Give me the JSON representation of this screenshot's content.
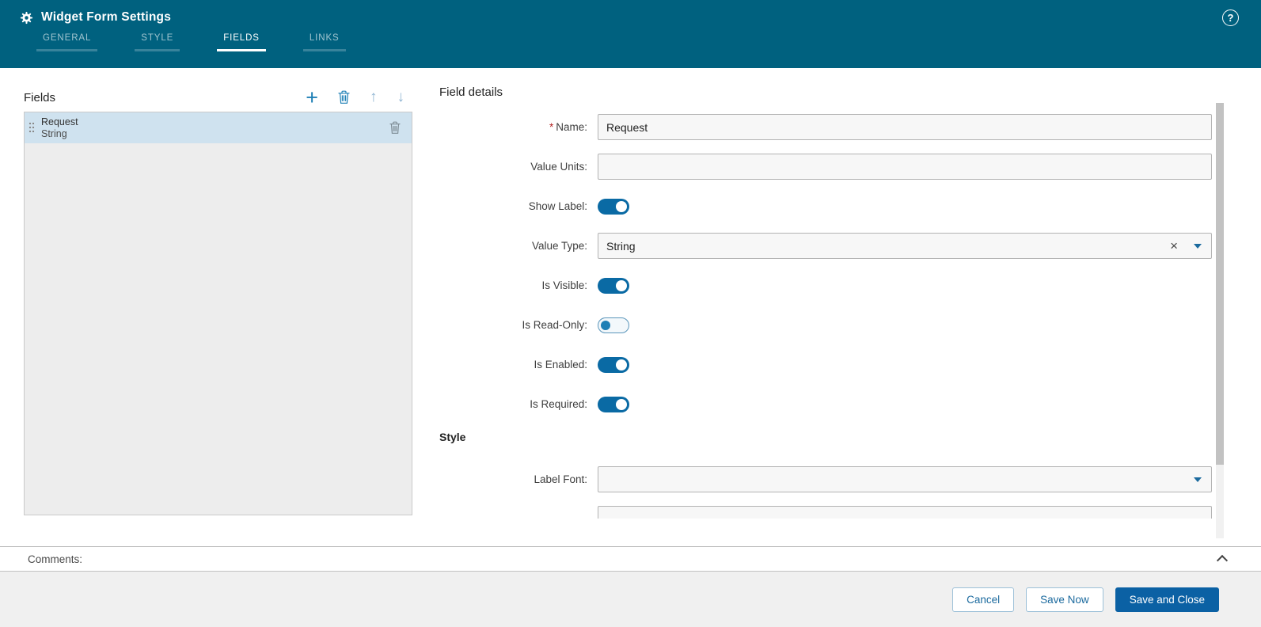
{
  "header": {
    "title": "Widget Form Settings",
    "help_label": "?",
    "tabs": [
      {
        "label": "GENERAL"
      },
      {
        "label": "STYLE"
      },
      {
        "label": "FIELDS"
      },
      {
        "label": "LINKS"
      }
    ],
    "active_tab": "FIELDS"
  },
  "fields_panel": {
    "title": "Fields",
    "selected_item": {
      "name": "Request",
      "type": "String"
    }
  },
  "details": {
    "title": "Field details",
    "rows": {
      "name": {
        "label": "Name:",
        "required_marker": "*",
        "value": "Request"
      },
      "value_units": {
        "label": "Value Units:",
        "value": ""
      },
      "show_label": {
        "label": "Show Label:",
        "state": "on"
      },
      "value_type": {
        "label": "Value Type:",
        "value": "String",
        "clear_icon": "×"
      },
      "is_visible": {
        "label": "Is Visible:",
        "state": "on"
      },
      "is_read_only": {
        "label": "Is Read-Only:",
        "state": "off"
      },
      "is_enabled": {
        "label": "Is Enabled:",
        "state": "on"
      },
      "is_required": {
        "label": "Is Required:",
        "state": "on"
      }
    },
    "style_section_title": "Style",
    "style_rows": {
      "label_font": {
        "label": "Label Font:",
        "value": ""
      }
    }
  },
  "comments": {
    "label": "Comments:"
  },
  "footer": {
    "cancel_label": "Cancel",
    "save_now_label": "Save Now",
    "save_and_close_label": "Save and Close"
  },
  "colors": {
    "header_bg": "#00617f",
    "accent": "#1d7fb5",
    "toggle_on": "#0a6aa4",
    "primary_button": "#0b61a4",
    "selected_row": "#cfe2ef"
  }
}
